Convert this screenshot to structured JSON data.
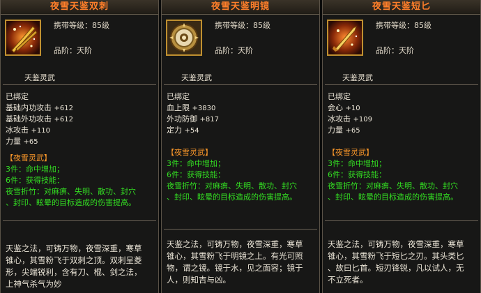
{
  "items": [
    {
      "title": "夜雪天鉴双刺",
      "icon": "twin-daggers-icon",
      "carry_label": "携带等级：85级",
      "grade_label": "品阶：天阶",
      "sub_title": "天鉴灵武",
      "bound": "已绑定",
      "stats": [
        {
          "name": "基础内功攻击",
          "value": "+612"
        },
        {
          "name": "基础外功攻击",
          "value": "+612"
        },
        {
          "name": "冰攻击",
          "value": "+110"
        },
        {
          "name": "力量",
          "value": "+65"
        }
      ],
      "set_name": "【夜雪灵武】",
      "set_lines": [
        "3件：命中增加；",
        "6件：获得技能：",
        "夜雪折竹：对麻痹、失明、散功、封穴",
        "、封印、眩晕的目标造成的伤害提高。"
      ],
      "desc": [
        "天鉴之法，可铸万物，夜雪深重，寒草",
        "锥心，其雪粉飞于双刺之顶。双刺呈菱",
        "形，尖端锐利，含有刀、棍、剑之法，",
        "上神气杀气为妙"
      ]
    },
    {
      "title": "夜雪天鉴明镜",
      "icon": "mirror-icon",
      "carry_label": "携带等级：85级",
      "grade_label": "品阶：天阶",
      "sub_title": "天鉴灵武",
      "bound": "已绑定",
      "stats": [
        {
          "name": "血上限",
          "value": "+3830"
        },
        {
          "name": "外功防御",
          "value": "+817"
        },
        {
          "name": "定力",
          "value": "+54"
        }
      ],
      "set_name": "【夜雪灵武】",
      "set_lines": [
        "3件：命中增加；",
        "6件：获得技能：",
        "夜雪折竹：对麻痹、失明、散功、封穴",
        "、封印、眩晕的目标造成的伤害提高。"
      ],
      "desc": [
        "天鉴之法，可铸万物，夜雪深重，寒草",
        "锥心，其雪粉飞于明镜之上。有光可照",
        "物，谓之镜。镜于水，见之面容；镜于",
        "人，则知吉与凶。"
      ]
    },
    {
      "title": "夜雪天鉴短匕",
      "icon": "dagger-icon",
      "carry_label": "携带等级：85级",
      "grade_label": "品阶：天阶",
      "sub_title": "天鉴灵武",
      "bound": "已绑定",
      "stats": [
        {
          "name": "会心",
          "value": "+10"
        },
        {
          "name": "冰攻击",
          "value": "+109"
        },
        {
          "name": "力量",
          "value": "+65"
        }
      ],
      "set_name": "【夜雪灵武】",
      "set_lines": [
        "3件：命中增加；",
        "6件：获得技能：",
        "夜雪折竹：对麻痹、失明、散功、封穴",
        "、封印、眩晕的目标造成的伤害提高。"
      ],
      "desc": [
        "天鉴之法，可铸万物，夜雪深重，寒草",
        "锥心，其雪粉飞于短匕之刃。其头类匕",
        "、故曰匕首。短刃锋锐，凡以试人，无",
        "不立死者。"
      ]
    }
  ],
  "colors": {
    "title": "#ff7f2a",
    "set_head": "#ff9a2a",
    "set_text": "#33dd22",
    "border": "#c09030"
  }
}
